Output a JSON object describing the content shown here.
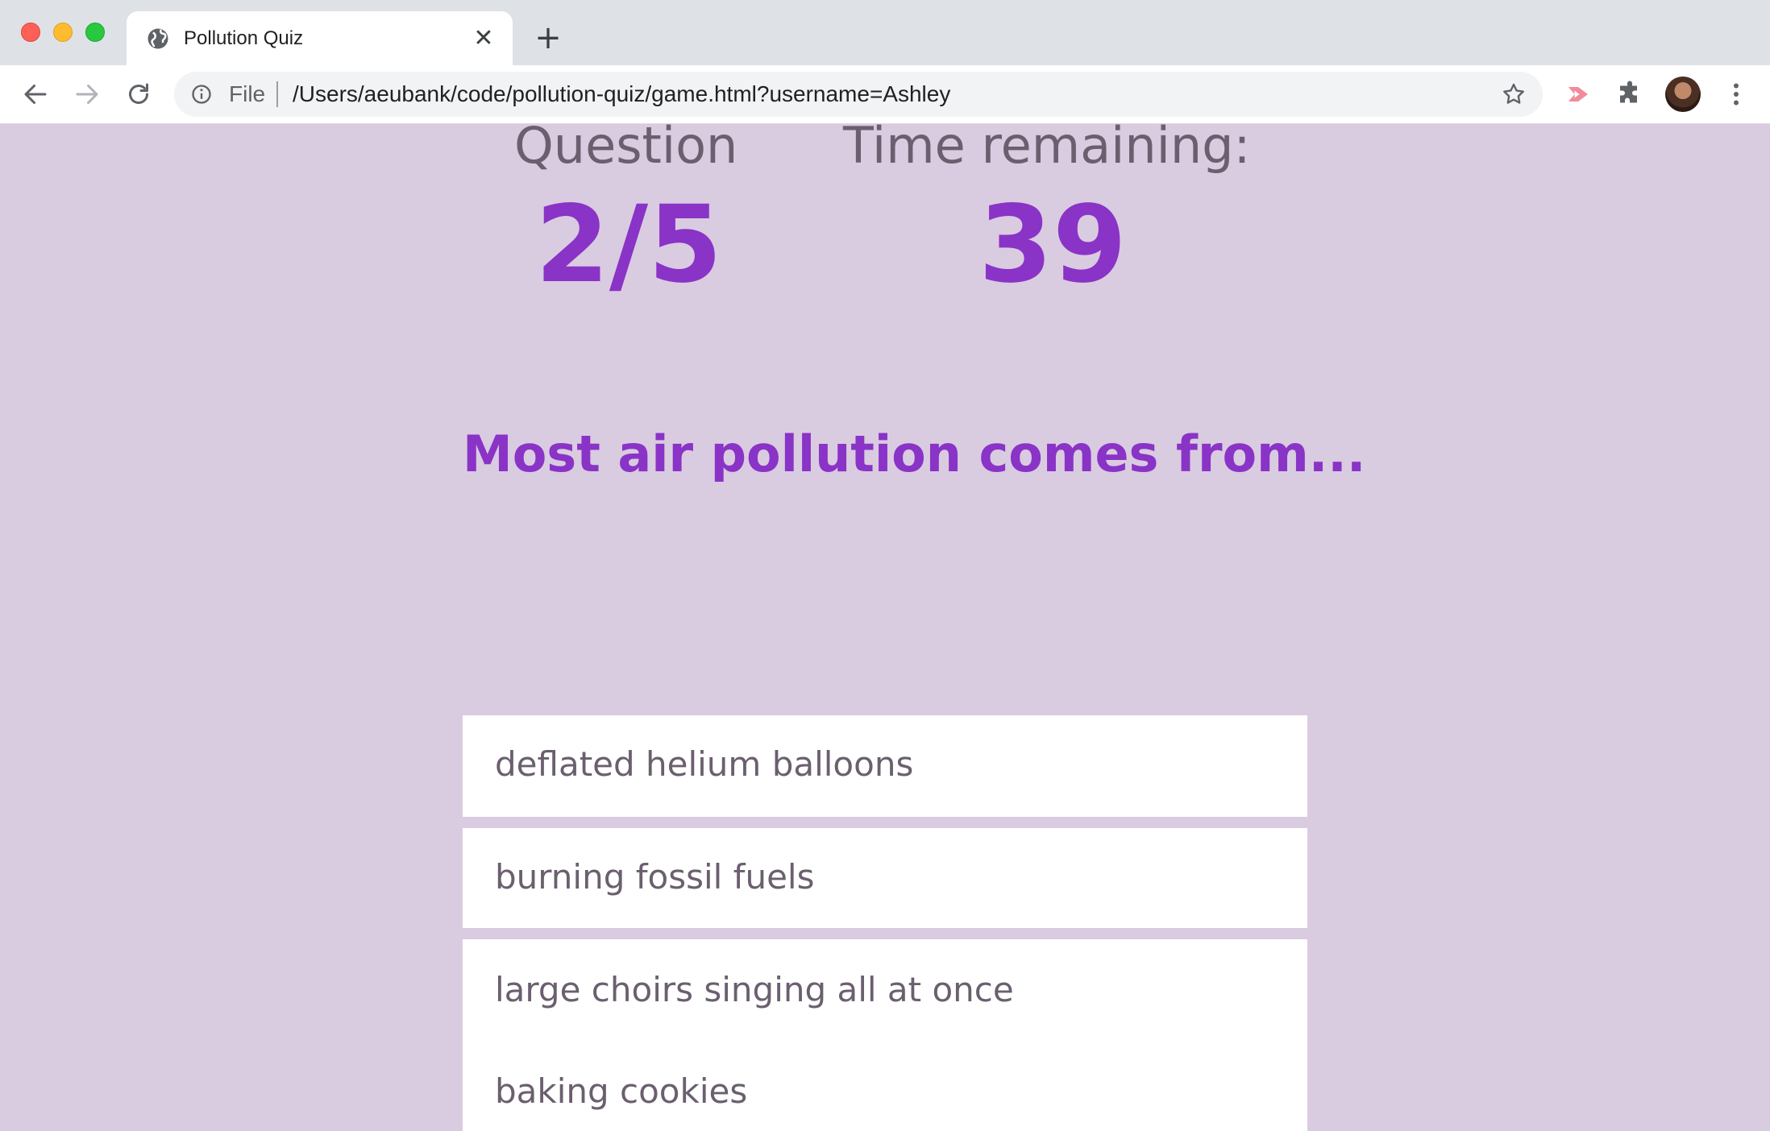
{
  "browser": {
    "tab_title": "Pollution Quiz",
    "omnibox": {
      "scheme_label": "File",
      "url": "/Users/aeubank/code/pollution-quiz/game.html?username=Ashley"
    },
    "icons": {
      "tab": "globe-icon",
      "close": "close-icon",
      "new_tab": "plus-icon",
      "back": "back-arrow-icon",
      "forward": "forward-arrow-icon",
      "reload": "reload-icon",
      "info": "info-icon",
      "bookmark": "star-icon",
      "extension_1": "cast-extension-icon",
      "extension_2": "puzzle-icon",
      "profile": "avatar",
      "menu": "kebab-menu-icon"
    }
  },
  "quiz": {
    "question_label": "Question",
    "question_progress": "2/5",
    "timer_label": "Time remaining:",
    "timer_value": "39",
    "question_text": "Most air pollution comes from...",
    "choices": [
      "deflated helium balloons",
      "burning fossil fuels",
      "large choirs singing all at once",
      "baking cookies"
    ]
  },
  "colors": {
    "page_background": "#d9cbe0",
    "accent": "#8a33c7",
    "text_muted": "#6b5f6f",
    "choice_background": "#ffffff"
  }
}
